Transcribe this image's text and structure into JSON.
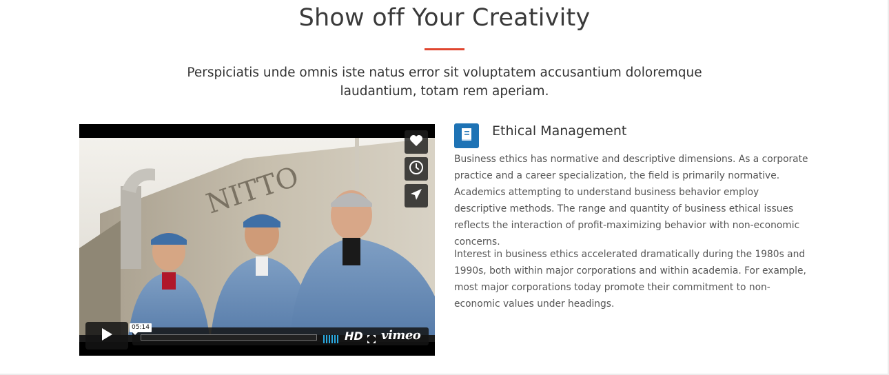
{
  "section": {
    "title": "Show off Your Creativity",
    "subtitle": "Perspiciatis unde omnis iste natus error sit voluptatem accusantium doloremque laudantium, totam rem aperiam.",
    "accent_color": "#e0452f"
  },
  "video": {
    "duration": "05:14",
    "quality_label": "HD",
    "brand_logo": "vimeo",
    "progress": 0.0,
    "side_buttons": [
      "heart-icon",
      "clock-icon",
      "send-icon"
    ]
  },
  "feature": {
    "icon": "book-icon",
    "icon_color": "#1e73b5",
    "title": "Ethical Management",
    "paragraphs": [
      "Business ethics has normative and descriptive dimensions. As a corporate practice and a career specialization, the field is primarily normative. Academics attempting to understand business behavior employ descriptive methods. The range and quantity of business ethical issues reflects the interaction of profit-maximizing behavior with non-economic concerns.",
      "Interest in business ethics accelerated dramatically during the 1980s and 1990s, both within major corporations and within academia. For example, most major corporations today promote their commitment to non-economic values under headings."
    ]
  }
}
